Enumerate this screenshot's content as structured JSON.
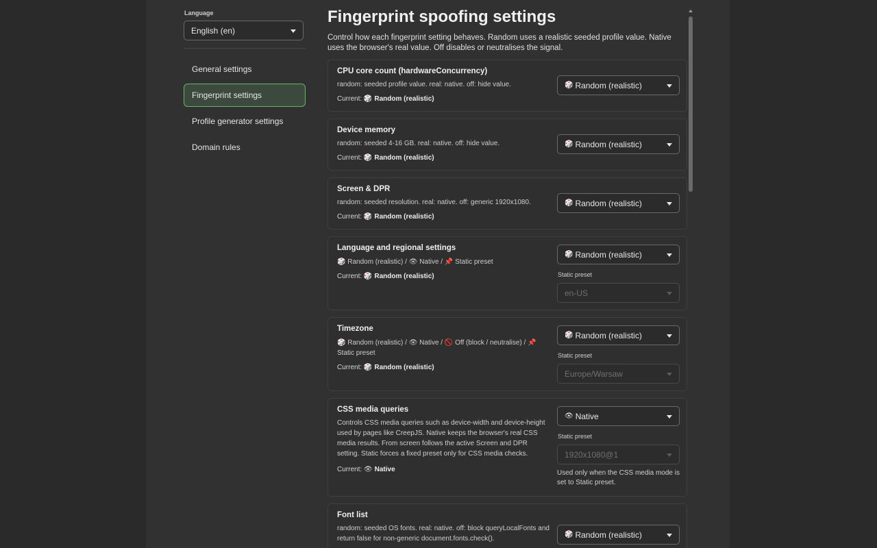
{
  "sidebar": {
    "language_label": "Language",
    "language_value": "English (en)",
    "items": [
      {
        "label": "General settings"
      },
      {
        "label": "Fingerprint settings"
      },
      {
        "label": "Profile generator settings"
      },
      {
        "label": "Domain rules"
      }
    ]
  },
  "main": {
    "title": "Fingerprint spoofing settings",
    "intro": "Control how each fingerprint setting behaves. Random uses a realistic seeded profile value. Native uses the browser's real value. Off disables or neutralises the signal.",
    "current_label": "Current:",
    "preset_label": "Static preset",
    "cards": [
      {
        "name": "CPU core count (hardwareConcurrency)",
        "desc": "random: seeded profile value. real: native. off: hide value.",
        "current_icon": "🎲",
        "current": "Random (realistic)",
        "select_icon": "🎲",
        "select": "Random (realistic)"
      },
      {
        "name": "Device memory",
        "desc": "random: seeded 4-16 GB. real: native. off: hide value.",
        "current_icon": "🎲",
        "current": "Random (realistic)",
        "select_icon": "🎲",
        "select": "Random (realistic)"
      },
      {
        "name": "Screen & DPR",
        "desc": "random: seeded resolution. real: native. off: generic 1920x1080.",
        "current_icon": "🎲",
        "current": "Random (realistic)",
        "select_icon": "🎲",
        "select": "Random (realistic)"
      },
      {
        "name": "Language and regional settings",
        "desc": "🎲 Random (realistic) / 👁 Native / 📌 Static preset",
        "current_icon": "🎲",
        "current": "Random (realistic)",
        "select_icon": "🎲",
        "select": "Random (realistic)",
        "preset_value": "en-US"
      },
      {
        "name": "Timezone",
        "desc": "🎲 Random (realistic) / 👁 Native / 🚫 Off (block / neutralise) / 📌 Static preset",
        "current_icon": "🎲",
        "current": "Random (realistic)",
        "select_icon": "🎲",
        "select": "Random (realistic)",
        "preset_value": "Europe/Warsaw"
      },
      {
        "name": "CSS media queries",
        "desc": "Controls CSS media queries such as device-width and device-height used by pages like CreepJS. Native keeps the browser's real CSS media results. From screen follows the active Screen and DPR setting. Static forces a fixed preset only for CSS media checks.",
        "current_icon": "👁",
        "current": "Native",
        "select_icon": "👁",
        "select": "Native",
        "preset_value": "1920x1080@1",
        "hint": "Used only when the CSS media mode is set to Static preset."
      },
      {
        "name": "Font list",
        "desc": "random: seeded OS fonts. real: native. off: block queryLocalFonts and return false for non-generic document.fonts.check().",
        "select_icon": "🎲",
        "select": "Random (realistic)"
      }
    ]
  }
}
